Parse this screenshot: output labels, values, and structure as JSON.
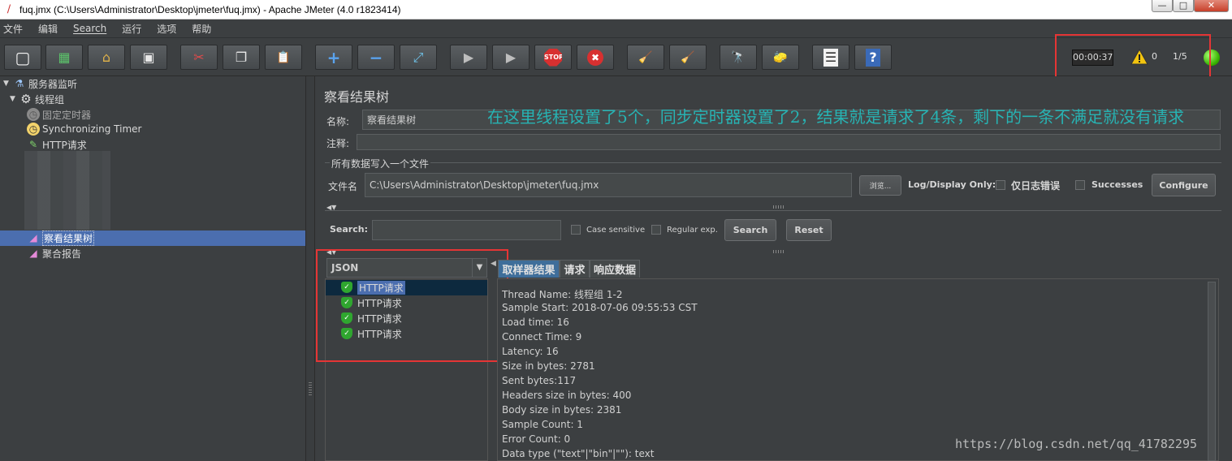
{
  "window": {
    "title": "fuq.jmx (C:\\Users\\Administrator\\Desktop\\jmeter\\fuq.jmx) - Apache JMeter (4.0 r1823414)",
    "controls": {
      "minimize": "—",
      "maximize": "□",
      "close": "✕"
    }
  },
  "menu": [
    "文件",
    "编辑",
    "Search",
    "运行",
    "选项",
    "帮助"
  ],
  "toolbar": {
    "buttons": [
      {
        "name": "new-icon",
        "glyph": "▢"
      },
      {
        "name": "templates-icon",
        "glyph": "▦"
      },
      {
        "name": "open-icon",
        "glyph": "⌂"
      },
      {
        "name": "save-icon",
        "glyph": "▣"
      },
      {
        "name": "cut-icon",
        "glyph": "✂"
      },
      {
        "name": "copy-icon",
        "glyph": "❐"
      },
      {
        "name": "paste-icon",
        "glyph": "📋"
      },
      {
        "name": "expand-icon",
        "glyph": "+"
      },
      {
        "name": "collapse-icon",
        "glyph": "−"
      },
      {
        "name": "toggle-icon",
        "glyph": "⤢"
      },
      {
        "name": "start-icon",
        "glyph": "▶"
      },
      {
        "name": "start-no-pause-icon",
        "glyph": "▶"
      },
      {
        "name": "stop-icon",
        "glyph": "STOP"
      },
      {
        "name": "shutdown-icon",
        "glyph": "✖"
      },
      {
        "name": "clear-icon",
        "glyph": "🧹"
      },
      {
        "name": "clear-all-icon",
        "glyph": "🧹"
      },
      {
        "name": "search-icon",
        "glyph": "🔭"
      },
      {
        "name": "reset-search-icon",
        "glyph": "🧽"
      },
      {
        "name": "function-helper-icon",
        "glyph": "☰"
      },
      {
        "name": "help-icon",
        "glyph": "?"
      }
    ],
    "timer": "00:00:37",
    "warnings": "0",
    "threads": "1/5",
    "colors": {
      "stop": "#d83030",
      "running": "#38b200"
    }
  },
  "tree": {
    "items": [
      {
        "label": "服务器监听",
        "icon": "flask-icon"
      },
      {
        "label": "线程组",
        "icon": "gear-icon"
      },
      {
        "label": "固定定时器",
        "icon": "timer-icon"
      },
      {
        "label": "Synchronizing Timer",
        "icon": "timer-icon"
      },
      {
        "label": "HTTP请求",
        "icon": "pipette-icon"
      },
      {
        "label": "察看结果树",
        "icon": "chart-icon"
      },
      {
        "label": "聚合报告",
        "icon": "chart-icon"
      }
    ]
  },
  "panel": {
    "heading": "察看结果树",
    "name_label": "名称:",
    "name_value": "察看结果树",
    "comment_label": "注释:",
    "comment_value": "",
    "file_section_title": "所有数据写入一个文件",
    "file_label": "文件名",
    "file_value": "C:\\Users\\Administrator\\Desktop\\jmeter\\fuq.jmx",
    "browse_button": "浏览...",
    "log_display_label": "Log/Display Only:",
    "errors_only_label": "仅日志错误",
    "successes_label": "Successes",
    "configure_button": "Configure",
    "search_label": "Search:",
    "search_value": "",
    "case_sensitive_label": "Case sensitive",
    "regular_exp_label": "Regular exp.",
    "search_button": "Search",
    "reset_button": "Reset",
    "renderer_value": "JSON",
    "annotation": "在这里线程设置了5个，同步定时器设置了2，结果就是请求了4条，剩下的一条不满足就没有请求"
  },
  "results": {
    "rows": [
      "HTTP请求",
      "HTTP请求",
      "HTTP请求",
      "HTTP请求"
    ],
    "tabs": [
      "取样器结果",
      "请求",
      "响应数据"
    ],
    "details": [
      "Thread Name: 线程组 1-2",
      "Sample Start: 2018-07-06 09:55:53 CST",
      "Load time: 16",
      "Connect Time: 9",
      "Latency: 16",
      "Size in bytes: 2781",
      "Sent bytes:117",
      "Headers size in bytes: 400",
      "Body size in bytes: 2381",
      "Sample Count: 1",
      "Error Count: 0",
      "Data type (\"text\"|\"bin\"|\"\"): text"
    ]
  },
  "watermark": "https://blog.csdn.net/qq_41782295"
}
